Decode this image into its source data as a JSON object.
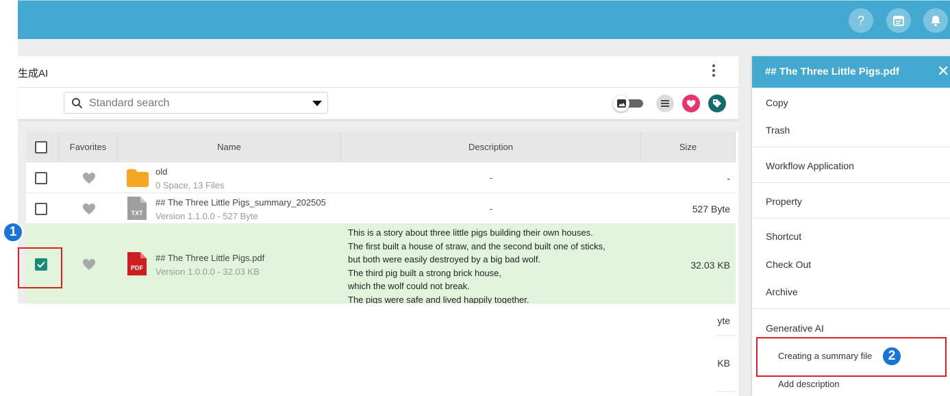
{
  "header": {
    "icons": [
      "help-icon",
      "calendar-icon",
      "bell-icon"
    ]
  },
  "panel": {
    "title": "生成AI"
  },
  "toolbar": {
    "search_placeholder": "Standard search"
  },
  "table": {
    "headers": {
      "favorites": "Favorites",
      "name": "Name",
      "description": "Description",
      "size": "Size"
    },
    "rows": [
      {
        "name": "old",
        "meta": "0 Space, 13 Files",
        "description": "-",
        "size": "-",
        "type": "folder",
        "selected": false
      },
      {
        "name": "## The Three Little Pigs_summary_202505",
        "meta": "Version 1.1.0.0 - 527 Byte",
        "description": "-",
        "size": "527 Byte",
        "type": "txt",
        "selected": false
      },
      {
        "name": "## The Three Little Pigs.pdf",
        "meta": "Version 1.0.0.0 - 32.03 KB",
        "description": [
          "This is a story about three little pigs building their own houses.",
          "The first built a house of straw, and the second built one of sticks,",
          "but both were easily destroyed by a big bad wolf.",
          "The third pig built a strong brick house,",
          "which the wolf could not break.",
          "The pigs were safe and lived happily together."
        ],
        "size": "32.03 KB",
        "type": "pdf",
        "selected": true
      }
    ],
    "partial_sizes": [
      "yte",
      "KB"
    ],
    "file_badges": {
      "txt": "TXT",
      "pdf": "PDF"
    }
  },
  "context_menu": {
    "title": "## The Three Little Pigs.pdf",
    "close": "✕",
    "items": {
      "copy": "Copy",
      "trash": "Trash",
      "workflow": "Workflow Application",
      "property": "Property",
      "shortcut": "Shortcut",
      "checkout": "Check Out",
      "archive": "Archive",
      "generative_ai": "Generative AI",
      "create_summary": "Creating a summary file",
      "add_description": "Add description"
    }
  },
  "annotations": {
    "step1": "1",
    "step2": "2"
  },
  "colors": {
    "header": "#44a9d0",
    "selected_row": "#e0f4dc",
    "checkbox_on": "#1a8a7a",
    "highlight": "#e02020",
    "badge": "#1a73d8",
    "folder": "#f5a623",
    "pdf": "#cc1f1f",
    "txt": "#9e9e9e"
  }
}
